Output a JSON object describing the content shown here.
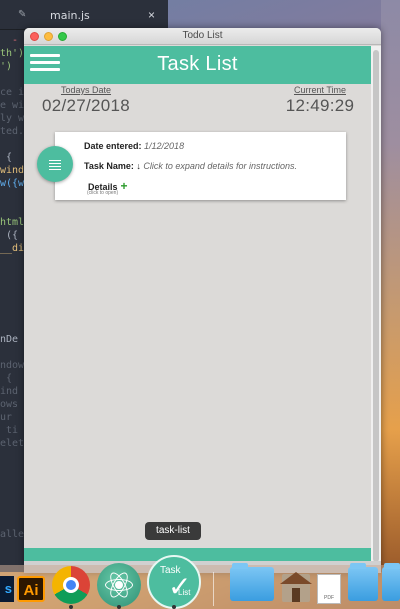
{
  "editor": {
    "tab_name": "main.js",
    "close_glyph": "×",
    "code_lines": [
      {
        "text": "  - (",
        "color": "#e06c75"
      },
      {
        "text": "th')",
        "color": "#98c379"
      },
      {
        "text": "')",
        "color": "#98c379"
      },
      {
        "text": "",
        "color": "#abb2bf"
      },
      {
        "text": "ce i",
        "color": "#5c6370"
      },
      {
        "text": "e wi",
        "color": "#5c6370"
      },
      {
        "text": "ly w",
        "color": "#5c6370"
      },
      {
        "text": "ted.",
        "color": "#5c6370"
      },
      {
        "text": "",
        "color": "#abb2bf"
      },
      {
        "text": " {",
        "color": "#abb2bf"
      },
      {
        "text": "wind",
        "color": "#e5c07b"
      },
      {
        "text": "w({w",
        "color": "#61afef"
      },
      {
        "text": "",
        "color": "#abb2bf"
      },
      {
        "text": "",
        "color": "#abb2bf"
      },
      {
        "text": "html",
        "color": "#98c379"
      },
      {
        "text": " ({",
        "color": "#abb2bf"
      },
      {
        "text": "__di",
        "color": "#e5c07b"
      },
      {
        "text": "",
        "color": "#abb2bf"
      },
      {
        "text": "",
        "color": "#abb2bf"
      },
      {
        "text": "",
        "color": "#abb2bf"
      },
      {
        "text": "",
        "color": "#abb2bf"
      },
      {
        "text": "",
        "color": "#abb2bf"
      },
      {
        "text": "",
        "color": "#abb2bf"
      },
      {
        "text": "nDe",
        "color": "#abb2bf"
      },
      {
        "text": "",
        "color": "#abb2bf"
      },
      {
        "text": "ndow",
        "color": "#5c6370"
      },
      {
        "text": " {",
        "color": "#5c6370"
      },
      {
        "text": "ind",
        "color": "#5c6370"
      },
      {
        "text": "ows",
        "color": "#5c6370"
      },
      {
        "text": "ur",
        "color": "#5c6370"
      },
      {
        "text": " ti",
        "color": "#5c6370"
      },
      {
        "text": "elet",
        "color": "#5c6370"
      },
      {
        "text": "",
        "color": "#abb2bf"
      },
      {
        "text": "",
        "color": "#abb2bf"
      },
      {
        "text": "",
        "color": "#abb2bf"
      },
      {
        "text": "",
        "color": "#abb2bf"
      },
      {
        "text": "",
        "color": "#abb2bf"
      },
      {
        "text": "",
        "color": "#abb2bf"
      },
      {
        "text": "alle",
        "color": "#5c6370"
      }
    ]
  },
  "window": {
    "title": "Todo List"
  },
  "app": {
    "title": "Task List",
    "accent_color": "#4dbd9f",
    "today_label": "Todays Date",
    "today_value": "02/27/2018",
    "time_label": "Current Time",
    "time_value": "12:49:29"
  },
  "task": {
    "date_label": "Date entered:",
    "date_value": "1/12/2018",
    "name_label": "Task Name:",
    "name_arrow": "↓",
    "name_hint": "Click to expand details for instructions.",
    "details_label": "Details",
    "details_plus": "+",
    "details_sub": "(click to open)"
  },
  "tooltip": {
    "text": "task-list"
  },
  "dock": {
    "ps_label": "s",
    "ai_label": "Ai",
    "task_top": "Task",
    "task_check": "✓",
    "task_bottom": "List",
    "pdf_label": "PDF"
  }
}
